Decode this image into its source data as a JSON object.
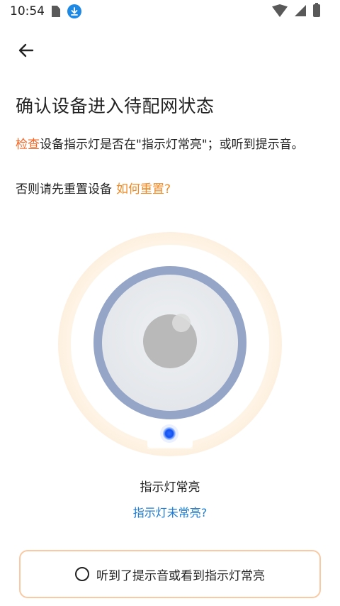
{
  "status_bar": {
    "time": "10:54",
    "icons": [
      "sim-card-icon",
      "download-icon",
      "wifi-icon",
      "signal-icon",
      "battery-icon"
    ]
  },
  "header": {
    "back_icon": "arrow-left-icon"
  },
  "page": {
    "title": "确认设备进入待配网状态",
    "instruction_link": "检查",
    "instruction_text": "设备指示灯是否在\"指示灯常亮\"；或听到提示音。",
    "reset_prefix": "否则请先重置设备",
    "reset_link": "如何重置?",
    "indicator_status": "指示灯常亮",
    "indicator_off_link": "指示灯未常亮?",
    "confirm_label": "听到了提示音或看到指示灯常亮"
  },
  "colors": {
    "accent_orange": "#f26522",
    "link_orange": "#f08a24",
    "link_blue": "#1a7ad6",
    "device_ring": "#95a5c8",
    "led_blue": "#1565ff",
    "button_border": "#f9c9a3"
  }
}
